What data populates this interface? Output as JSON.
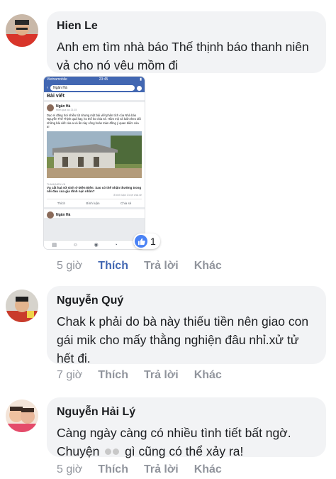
{
  "comments": [
    {
      "author": "Hien Le",
      "text": "Anh em tìm nhà báo Thế thịnh báo thanh niên vả cho nó vêu mồm đi",
      "time": "5 giờ",
      "like_label": "Thích",
      "reply_label": "Trả lời",
      "more_label": "Khác",
      "liked": true,
      "reaction_count": "1",
      "shared_screenshot": {
        "status_left": "Vietnamobile",
        "status_time": "23:45",
        "search_text": "Ngân Hà",
        "section_title": "Bài viết",
        "post_author": "Ngân Hà",
        "post_meta": "Hôm qua lúc 21:15",
        "post_body": "Dạo ni đăng hơi nhiều tút nhưng một bài viết phân tích của Nhà báo Nguyễn Thế Thịnh quá hay, ko thể ko chia sẻ. Hầm mộ và luôn theo dõi những bài viết của a và ấn này công hoàn toàn đồng ý quan điểm của a!",
        "link_source": "THANHNIEN.VN",
        "link_title": "Vụ cắt hại nữ sinh ở Điện Biên: Sao có thể nhận thường trong nỗi đau của gia đình nạn nhân?",
        "counts": "8 bình luận  1 lượt chia sẻ",
        "action_like": "Thích",
        "action_comment": "Bình luận",
        "action_share": "Chia sẻ",
        "next_post_author": "Ngân Hà"
      }
    },
    {
      "author": "Nguyễn Quý",
      "text": "Chak k phải do bà này thiếu tiền nên giao con gái mik cho mấy thằng nghiện đâu nhỉ.xử tử hết đi.",
      "time": "7 giờ",
      "like_label": "Thích",
      "reply_label": "Trả lời",
      "more_label": "Khác",
      "liked": false
    },
    {
      "author": "Nguyễn Hải Lý",
      "text_part1": "Càng ngày càng có nhiều tình tiết bất ngờ. Chuyện",
      "text_part2": "gì cũng có thể xảy ra!",
      "time": "5 giờ",
      "like_label": "Thích",
      "reply_label": "Trả lời",
      "more_label": "Khác",
      "liked": false
    }
  ],
  "colors": {
    "bubble": "#f2f3f5",
    "action_gray": "#90949c",
    "liked_blue": "#4267b2",
    "facebook_blue": "#4267b2"
  }
}
